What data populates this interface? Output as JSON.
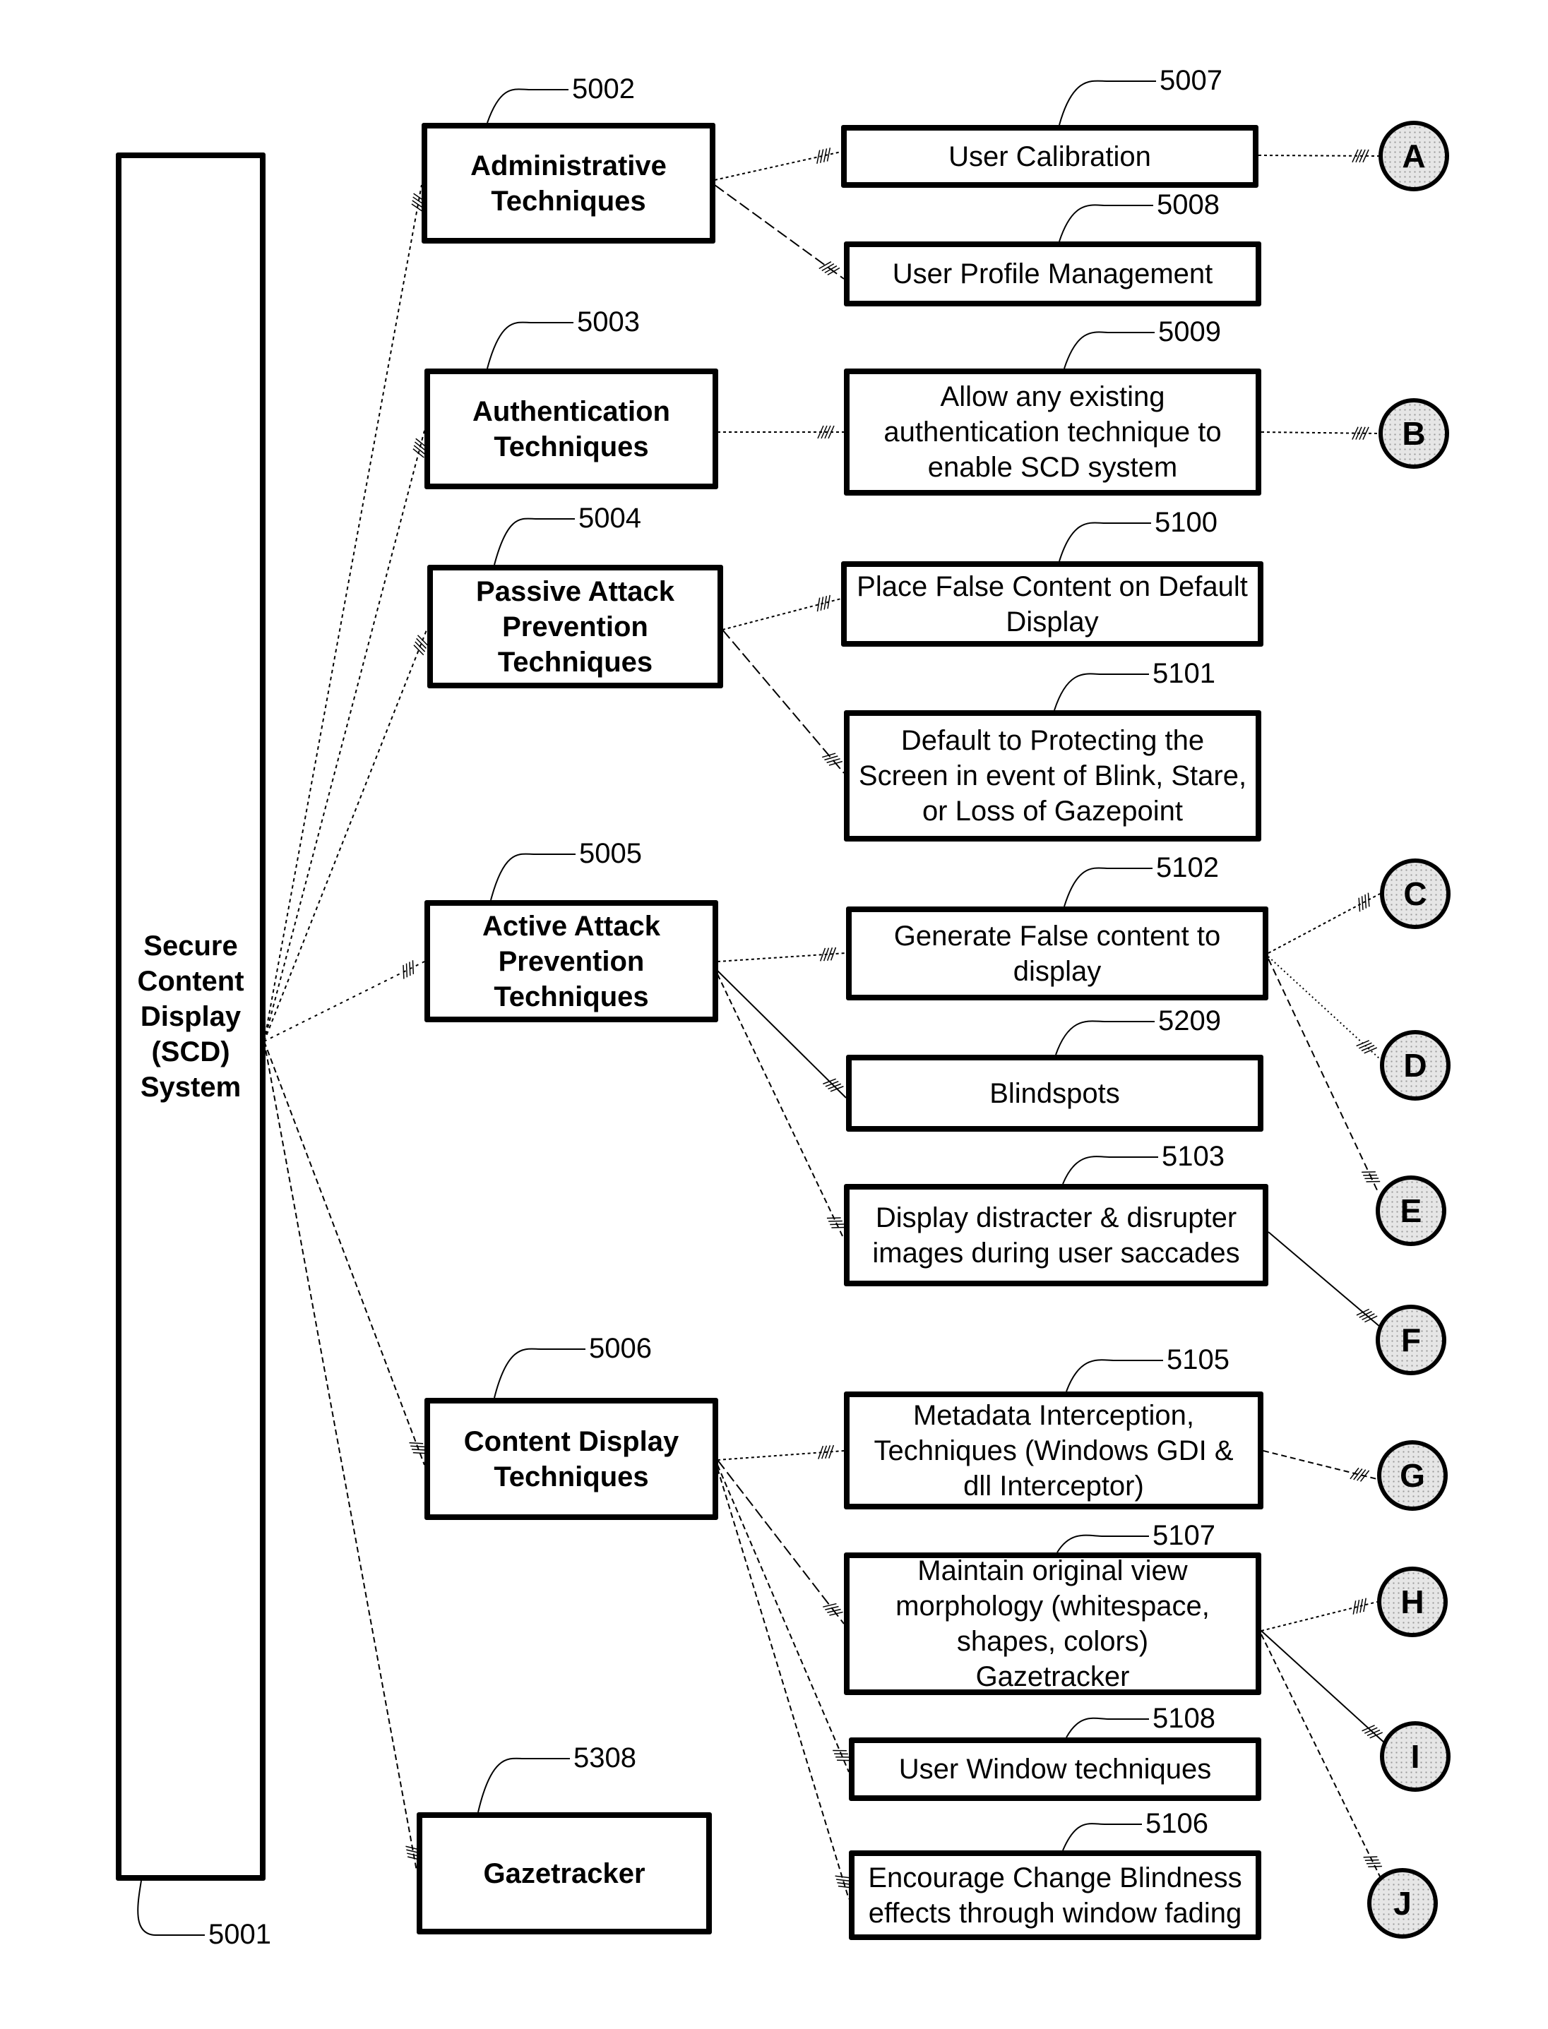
{
  "diagram": {
    "root": {
      "id": "scd",
      "ref": "5001",
      "label": "Secure Content Display (SCD) System",
      "lines": [
        "Secure",
        "Content",
        "Display",
        "(SCD)",
        "System"
      ]
    },
    "categories": [
      {
        "id": "admin",
        "ref": "5002",
        "lines": [
          "Administrative",
          "Techniques"
        ]
      },
      {
        "id": "auth",
        "ref": "5003",
        "lines": [
          "Authentication",
          "Techniques"
        ]
      },
      {
        "id": "passive",
        "ref": "5004",
        "lines": [
          "Passive Attack",
          "Prevention",
          "Techniques"
        ]
      },
      {
        "id": "active",
        "ref": "5005",
        "lines": [
          "Active Attack",
          "Prevention",
          "Techniques"
        ]
      },
      {
        "id": "content",
        "ref": "5006",
        "lines": [
          "Content Display",
          "Techniques"
        ]
      },
      {
        "id": "gaze",
        "ref": "5308",
        "lines": [
          "Gazetracker"
        ]
      }
    ],
    "techniques": [
      {
        "id": "calib",
        "ref": "5007",
        "parent": "admin",
        "lines": [
          "User Calibration"
        ]
      },
      {
        "id": "profile",
        "ref": "5008",
        "parent": "admin",
        "lines": [
          "User Profile Management"
        ]
      },
      {
        "id": "allow",
        "ref": "5009",
        "parent": "auth",
        "lines": [
          "Allow any existing",
          "authentication technique to",
          "enable SCD system"
        ]
      },
      {
        "id": "placefalse",
        "ref": "5100",
        "parent": "passive",
        "lines": [
          "Place False Content on Default",
          "Display"
        ]
      },
      {
        "id": "default",
        "ref": "5101",
        "parent": "passive",
        "lines": [
          "Default to Protecting the",
          "Screen in event of Blink, Stare,",
          "or Loss of Gazepoint"
        ]
      },
      {
        "id": "generate",
        "ref": "5102",
        "parent": "active",
        "lines": [
          "Generate False content to",
          "display"
        ]
      },
      {
        "id": "blind",
        "ref": "5209",
        "parent": "active",
        "lines": [
          "Blindspots"
        ]
      },
      {
        "id": "distract",
        "ref": "5103",
        "parent": "active",
        "lines": [
          "Display distracter & disrupter",
          "images during user saccades"
        ]
      },
      {
        "id": "metadata",
        "ref": "5105",
        "parent": "content",
        "lines": [
          "Metadata Interception,",
          "Techniques (Windows GDI &",
          "dll Interceptor)"
        ]
      },
      {
        "id": "maintain",
        "ref": "5107",
        "parent": "content",
        "lines": [
          "Maintain original view",
          "morphology (whitespace,",
          "shapes, colors)",
          "Gazetracker"
        ]
      },
      {
        "id": "userwin",
        "ref": "5108",
        "parent": "content",
        "lines": [
          "User Window techniques"
        ]
      },
      {
        "id": "encourage",
        "ref": "5106",
        "parent": "content",
        "lines": [
          "Encourage Change Blindness",
          "effects through window fading"
        ]
      }
    ],
    "connectors": [
      {
        "label": "A",
        "from": "calib"
      },
      {
        "label": "B",
        "from": "allow"
      },
      {
        "label": "C",
        "from": "generate"
      },
      {
        "label": "D",
        "from": "generate"
      },
      {
        "label": "E",
        "from": "generate"
      },
      {
        "label": "F",
        "from": "distract"
      },
      {
        "label": "G",
        "from": "metadata"
      },
      {
        "label": "H",
        "from": "maintain"
      },
      {
        "label": "I",
        "from": "maintain"
      },
      {
        "label": "J",
        "from": "maintain"
      }
    ]
  }
}
